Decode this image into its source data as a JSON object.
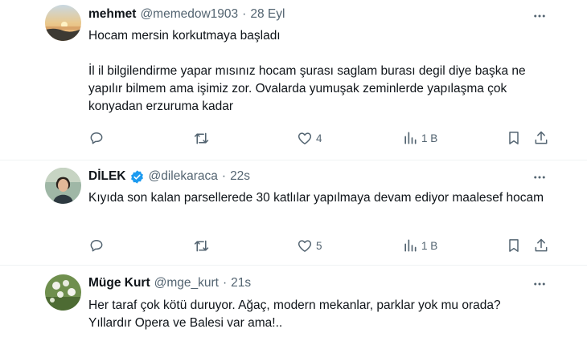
{
  "tweets": [
    {
      "name": "mehmet",
      "handle": "@memedow1903",
      "separator": "·",
      "time": "28 Eyl",
      "verified": false,
      "avatar": "sunset-landscape",
      "text_lines": [
        "Hocam mersin korkutmaya  başladı",
        "",
        "İl il bilgilendirme yapar mısınız  hocam şurası saglam burası degil diye başka ne yapılır bilmem ama işimiz zor.   Ovalarda yumuşak zeminlerde yapılaşma çok konyadan erzuruma kadar"
      ],
      "stats": {
        "replies": "",
        "retweets": "",
        "likes": "4",
        "views": "1 B"
      }
    },
    {
      "name": "DİLEK",
      "handle": "@dilekaraca",
      "separator": "·",
      "time": "22s",
      "verified": true,
      "avatar": "woman-portrait",
      "text_lines": [
        "Kıyıda son kalan parsellerede 30 katlılar yapılmaya devam ediyor maalesef hocam"
      ],
      "stats": {
        "replies": "",
        "retweets": "",
        "likes": "5",
        "views": "1 B"
      }
    },
    {
      "name": "Müge Kurt",
      "handle": "@mge_kurt",
      "separator": "·",
      "time": "21s",
      "verified": false,
      "avatar": "flowers",
      "text_lines": [
        "Her taraf çok kötü duruyor. Ağaç, modern mekanlar, parklar yok mu orada?",
        "Yıllardır Opera ve Balesi var ama!.."
      ]
    }
  ],
  "icons": {
    "more": "more-horizontal-icon",
    "reply": "reply-icon",
    "retweet": "retweet-icon",
    "like": "heart-icon",
    "views": "views-icon",
    "bookmark": "bookmark-icon",
    "share": "share-icon",
    "verified": "verified-badge-icon"
  },
  "colors": {
    "text": "#0f1419",
    "muted": "#536471",
    "verified": "#1d9bf0",
    "divider": "#eff3f4"
  }
}
